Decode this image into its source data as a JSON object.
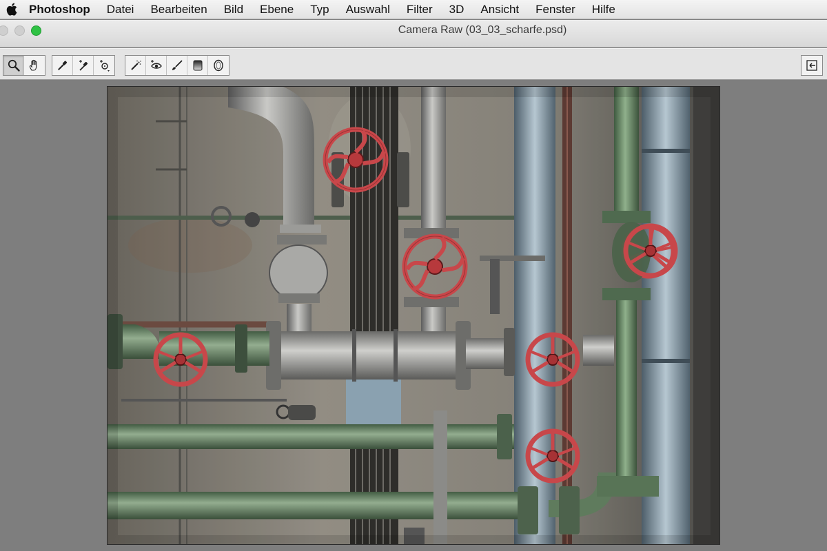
{
  "menubar": {
    "apple_icon": "apple-icon",
    "items": [
      "Photoshop",
      "Datei",
      "Bearbeiten",
      "Bild",
      "Ebene",
      "Typ",
      "Auswahl",
      "Filter",
      "3D",
      "Ansicht",
      "Fenster",
      "Hilfe"
    ]
  },
  "window": {
    "title": "Camera Raw (03_03_scharfe.psd)"
  },
  "toolbar": {
    "tools": [
      "zoom-icon",
      "hand-icon",
      "white-balance-icon",
      "color-sampler-icon",
      "targeted-adjustment-icon",
      "spot-removal-icon",
      "red-eye-icon",
      "adjustment-brush-icon",
      "graduated-filter-icon",
      "radial-filter-icon"
    ],
    "active_tool": "zoom-icon",
    "export_icon": "open-in-photoshop-icon"
  },
  "canvas": {
    "background": "#7e7e7e",
    "photo_subject": "industrial-pipes-valves"
  },
  "colors": {
    "valve_red": "#c8474a",
    "pipe_green": "#7a9a78",
    "pipe_blue": "#8ea4b2",
    "wall": "#8f8b82"
  }
}
